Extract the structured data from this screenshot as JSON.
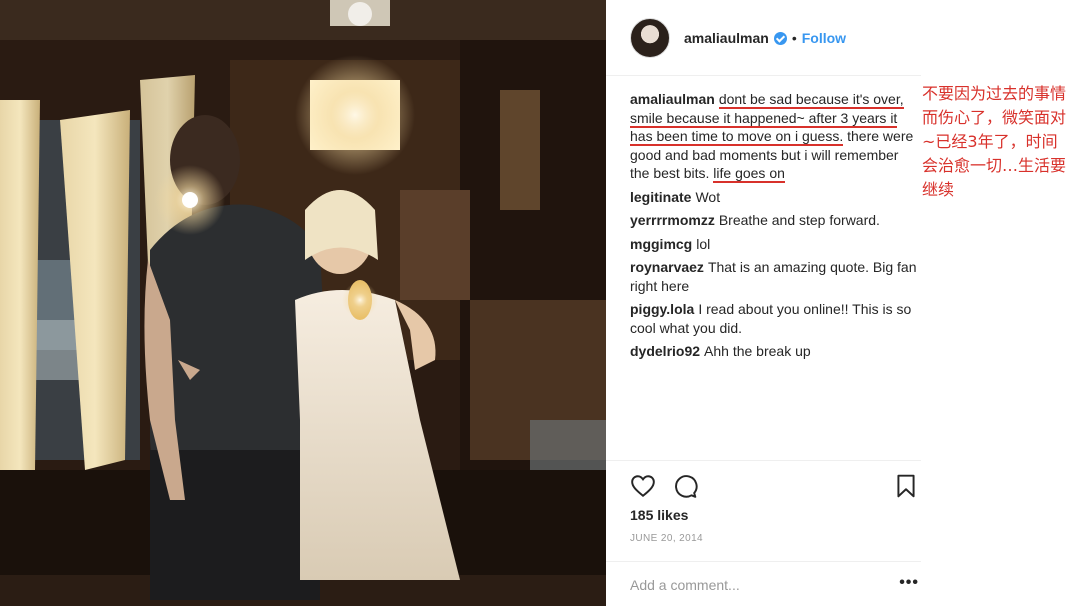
{
  "header": {
    "username": "amaliaulman",
    "follow_label": "Follow",
    "separator": "•"
  },
  "caption": {
    "username": "amaliaulman",
    "segments": [
      {
        "text": "dont be sad because it's over, smile because it happened~ after 3 years it has been time to move on i guess.",
        "underlined": true
      },
      {
        "text": " there were good and bad moments but i will remember the best bits. ",
        "underlined": false
      },
      {
        "text": "life goes on",
        "underlined": true
      }
    ]
  },
  "comments": [
    {
      "user": "legitinate",
      "text": "Wot"
    },
    {
      "user": "yerrrrmomzz",
      "text": "Breathe and step forward."
    },
    {
      "user": "mggimcg",
      "text": "lol"
    },
    {
      "user": "roynarvaez",
      "text": "That is an amazing quote. Big fan right here"
    },
    {
      "user": "piggy.lola",
      "text": "I read about you online!! This is so cool what you did."
    },
    {
      "user": "dydelrio92",
      "text": "Ahh the break up"
    }
  ],
  "actions": {
    "likes": "185 likes",
    "date": "JUNE 20, 2014",
    "add_comment_placeholder": "Add a comment...",
    "more_label": "•••",
    "icons": [
      "heart-icon",
      "comment-icon",
      "bookmark-icon"
    ]
  },
  "annotation": {
    "text": "不要因为过去的事情而伤心了，微笑面对~已经3年了，时间会治愈一切…生活要继续",
    "color": "#d8312b"
  },
  "colors": {
    "accent": "#3897f0",
    "underline": "#d8312b",
    "muted": "#999999"
  }
}
